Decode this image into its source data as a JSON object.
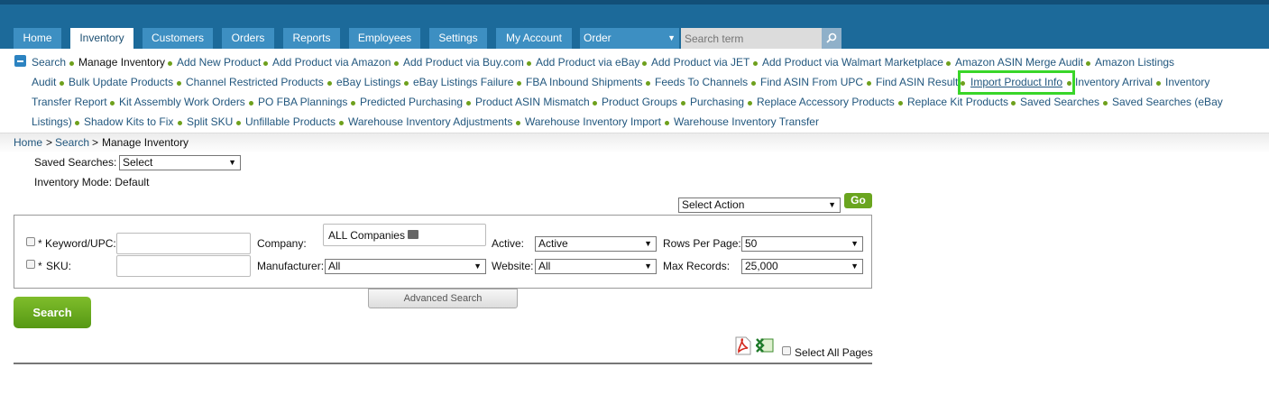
{
  "nav": {
    "tabs": [
      "Home",
      "Inventory",
      "Customers",
      "Orders",
      "Reports",
      "Employees",
      "Settings",
      "My Account"
    ],
    "active_tab": "Inventory",
    "order_select": "Order",
    "search_placeholder": "Search term"
  },
  "links": [
    "Search",
    "Manage Inventory",
    "Add New Product",
    "Add Product via Amazon",
    "Add Product via Buy.com",
    "Add Product via eBay",
    "Add Product via JET",
    "Add Product via Walmart Marketplace",
    "Amazon ASIN Merge Audit",
    "Amazon Listings",
    "Audit",
    "Bulk Update Products",
    "Channel Restricted Products",
    "eBay Listings",
    "eBay Listings Failure",
    "FBA Inbound Shipments",
    "Feeds To Channels",
    "Find ASIN From UPC",
    "Find ASIN Result",
    "Import Product Info",
    "Inventory Arrival",
    "Inventory",
    "Transfer Report",
    "Kit Assembly Work Orders",
    "PO FBA Plannings",
    "Predicted Purchasing",
    "Product ASIN Mismatch",
    "Product Groups",
    "Purchasing",
    "Replace Accessory Products",
    "Replace Kit Products",
    "Saved Searches",
    "Saved Searches (eBay",
    "Listings)",
    "Shadow Kits to Fix",
    "Split SKU",
    "Unfillable Products",
    "Warehouse Inventory Adjustments",
    "Warehouse Inventory Import",
    "Warehouse Inventory Transfer"
  ],
  "breadcrumb": {
    "home": "Home",
    "sep1": ">",
    "search": "Search",
    "sep2": ">",
    "current": "Manage Inventory"
  },
  "saved_searches": {
    "label": "Saved Searches:",
    "value": "Select"
  },
  "inventory_mode": "Inventory Mode: Default",
  "action": {
    "select": "Select Action",
    "go": "Go"
  },
  "filters": {
    "keyword_label": "* Keyword/UPC:",
    "sku_star": "*",
    "sku_label": "SKU:",
    "company_label": "Company:",
    "company_value": "ALL Companies",
    "manufacturer_label": "Manufacturer:",
    "manufacturer_value": "All",
    "active_label": "Active:",
    "active_value": "Active",
    "website_label": "Website:",
    "website_value": "All",
    "rows_label": "Rows Per Page:",
    "rows_value": "50",
    "max_label": "Max Records:",
    "max_value": "25,000"
  },
  "advanced_search": "Advanced Search",
  "search_button": "Search",
  "select_all_pages": "Select All Pages",
  "colors": {
    "nav_bg": "#1c6a9a",
    "tab_bg": "#3d8fc2",
    "link": "#22577e",
    "bullet": "#6ea01c",
    "highlight": "#39d629",
    "button_green": "#6aa51f"
  }
}
